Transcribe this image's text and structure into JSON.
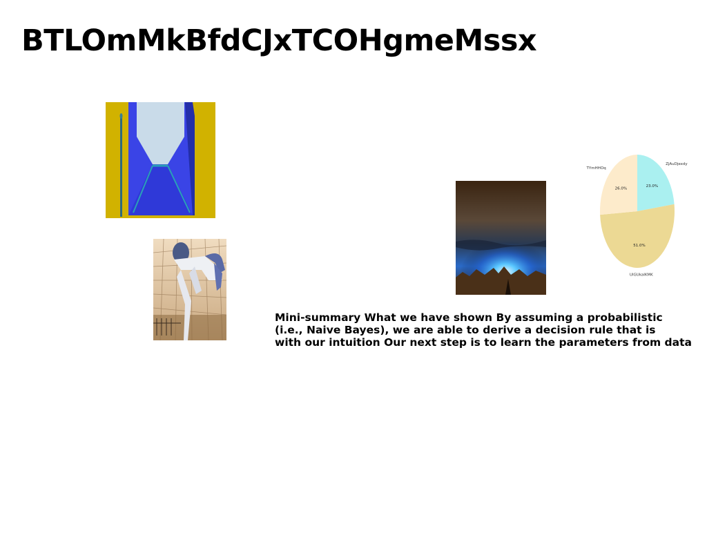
{
  "page": {
    "title": "BTLOmMkBfdCJxTCOHgmeMssx",
    "body_text": "Mini-summary What we have shown By assuming a probabilistic\n(i.e., Naive Bayes), we are able to derive a decision rule that is\nwith our intuition Our next step is to learn the parameters from data"
  },
  "images": [
    {
      "name": "blue-envelope-image"
    },
    {
      "name": "man-reaching-image"
    },
    {
      "name": "blue-glow-landscape-image"
    }
  ],
  "chart_data": {
    "type": "pie",
    "title": "",
    "slices": [
      {
        "label": "ZjAuDjexdy",
        "value": 23.0,
        "value_label": "23.0%",
        "color": "#aaf0f0"
      },
      {
        "label": "UlGUkaIKMK",
        "value": 51.0,
        "value_label": "51.0%",
        "color": "#ecd994"
      },
      {
        "label": "TYmHHOq",
        "value": 26.0,
        "value_label": "26.0%",
        "color": "#fdebcb"
      }
    ],
    "start": "top",
    "direction": "clockwise",
    "legend": "none"
  }
}
